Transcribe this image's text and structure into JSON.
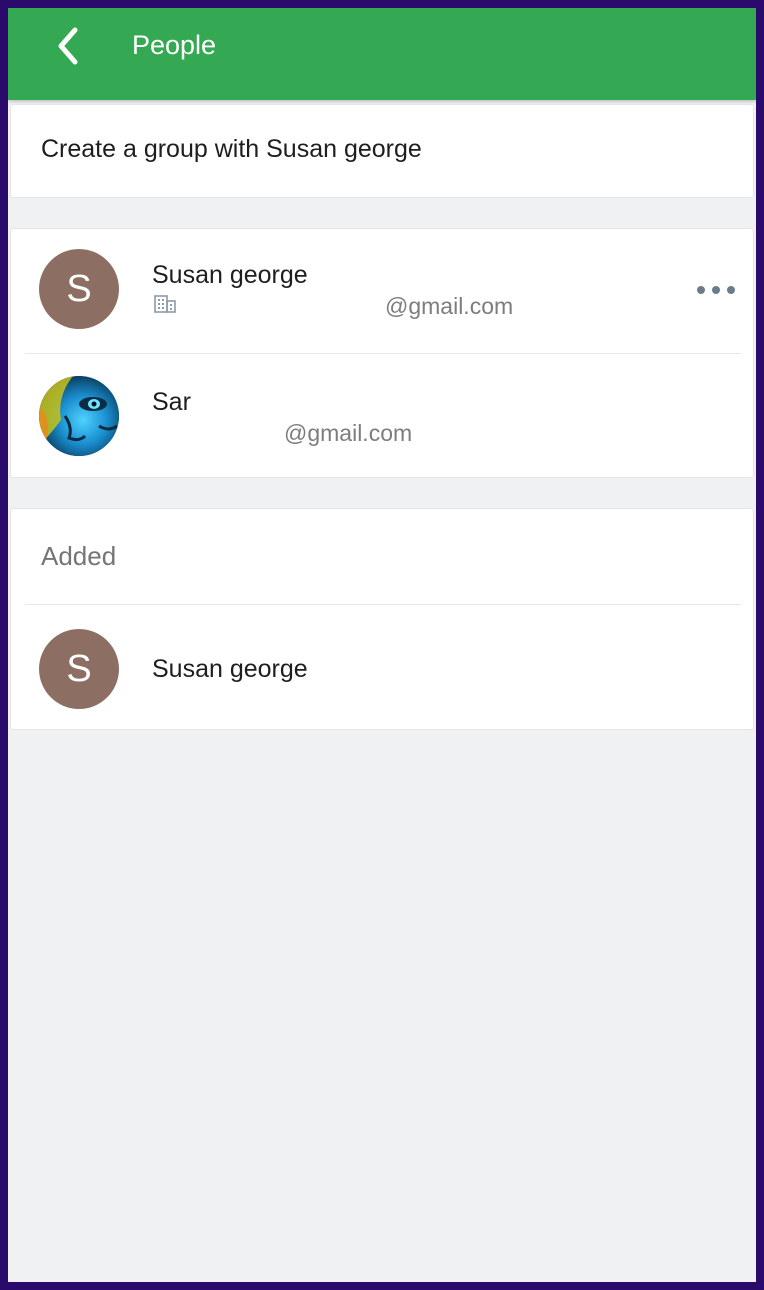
{
  "header": {
    "title": "People",
    "back_icon": "chevron-left-icon",
    "bg_color": "#34a853"
  },
  "create_group": {
    "label": "Create a group with Susan george"
  },
  "people": [
    {
      "name": "Susan george",
      "initial": "S",
      "email": "@gmail.com",
      "avatar_color": "#8d6e63",
      "org_icon": "building-icon",
      "more_icon": "more-horizontal-icon"
    },
    {
      "name": "Sar",
      "email": "@gmail.com",
      "avatar": "photo"
    }
  ],
  "added": {
    "header": "Added",
    "items": [
      {
        "name": "Susan george",
        "initial": "S",
        "avatar_color": "#8d6e63"
      }
    ]
  }
}
